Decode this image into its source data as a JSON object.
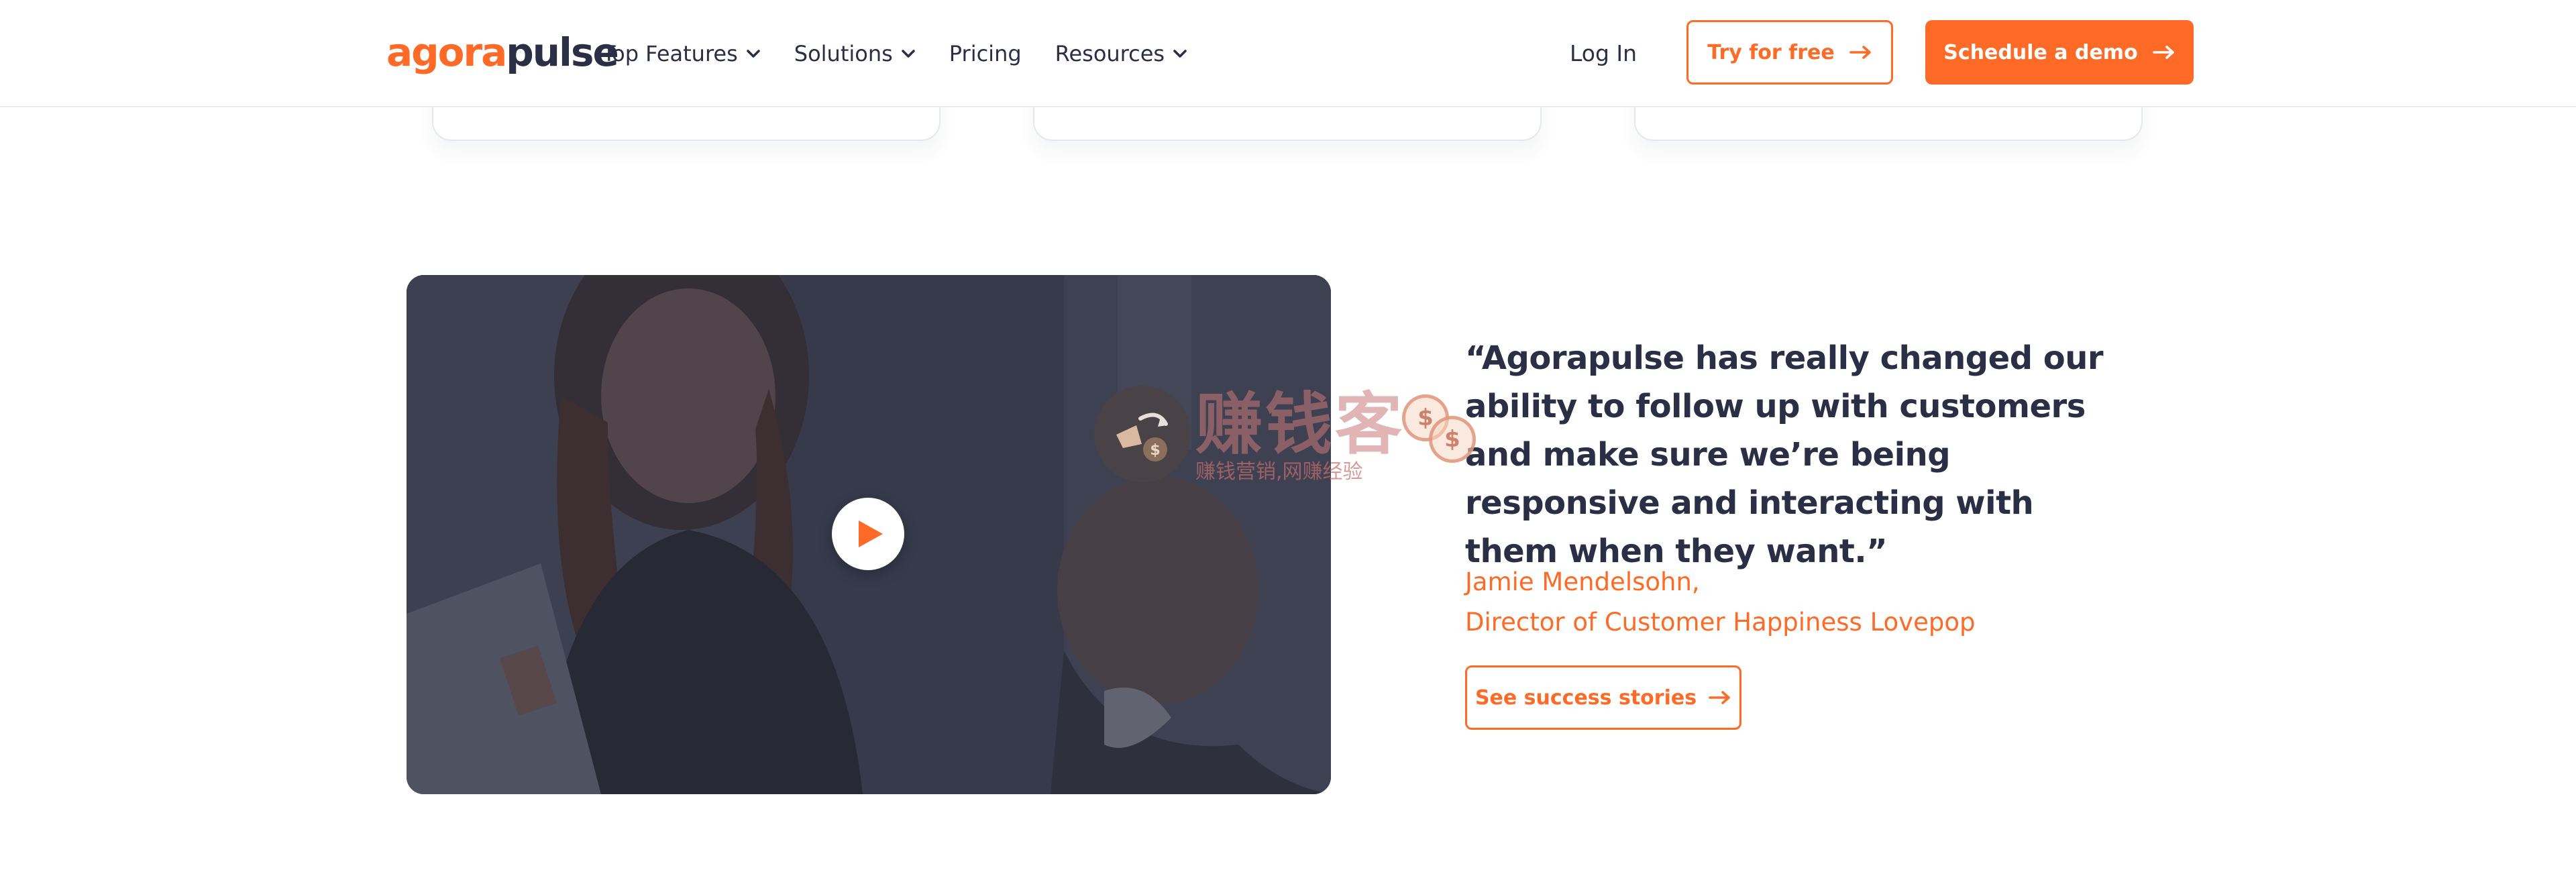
{
  "header": {
    "logo": {
      "part1": "agora",
      "part2": "pulse"
    },
    "nav": [
      {
        "label": "Top Features",
        "has_dropdown": true
      },
      {
        "label": "Solutions",
        "has_dropdown": true
      },
      {
        "label": "Pricing",
        "has_dropdown": false
      },
      {
        "label": "Resources",
        "has_dropdown": true
      }
    ],
    "login_label": "Log In",
    "try_free_label": "Try for free",
    "demo_label": "Schedule a demo"
  },
  "testimonial": {
    "quote": "“Agorapulse has really changed our ability to follow up with customers and make sure we’re being responsive and interacting with them when they want.”",
    "author_name": "Jamie Mendelsohn,",
    "author_title": "Director of Customer Happiness Lovepop",
    "cta_label": "See success stories"
  },
  "video": {
    "play_icon": "play-icon"
  },
  "watermark": {
    "title": "赚钱客",
    "subtitle": "赚钱营销,网赚经验",
    "coin_symbol": "$"
  },
  "colors": {
    "brand_orange": "#ff6b26",
    "text_dark": "#2a2f45",
    "video_overlay": "#2e3142"
  }
}
